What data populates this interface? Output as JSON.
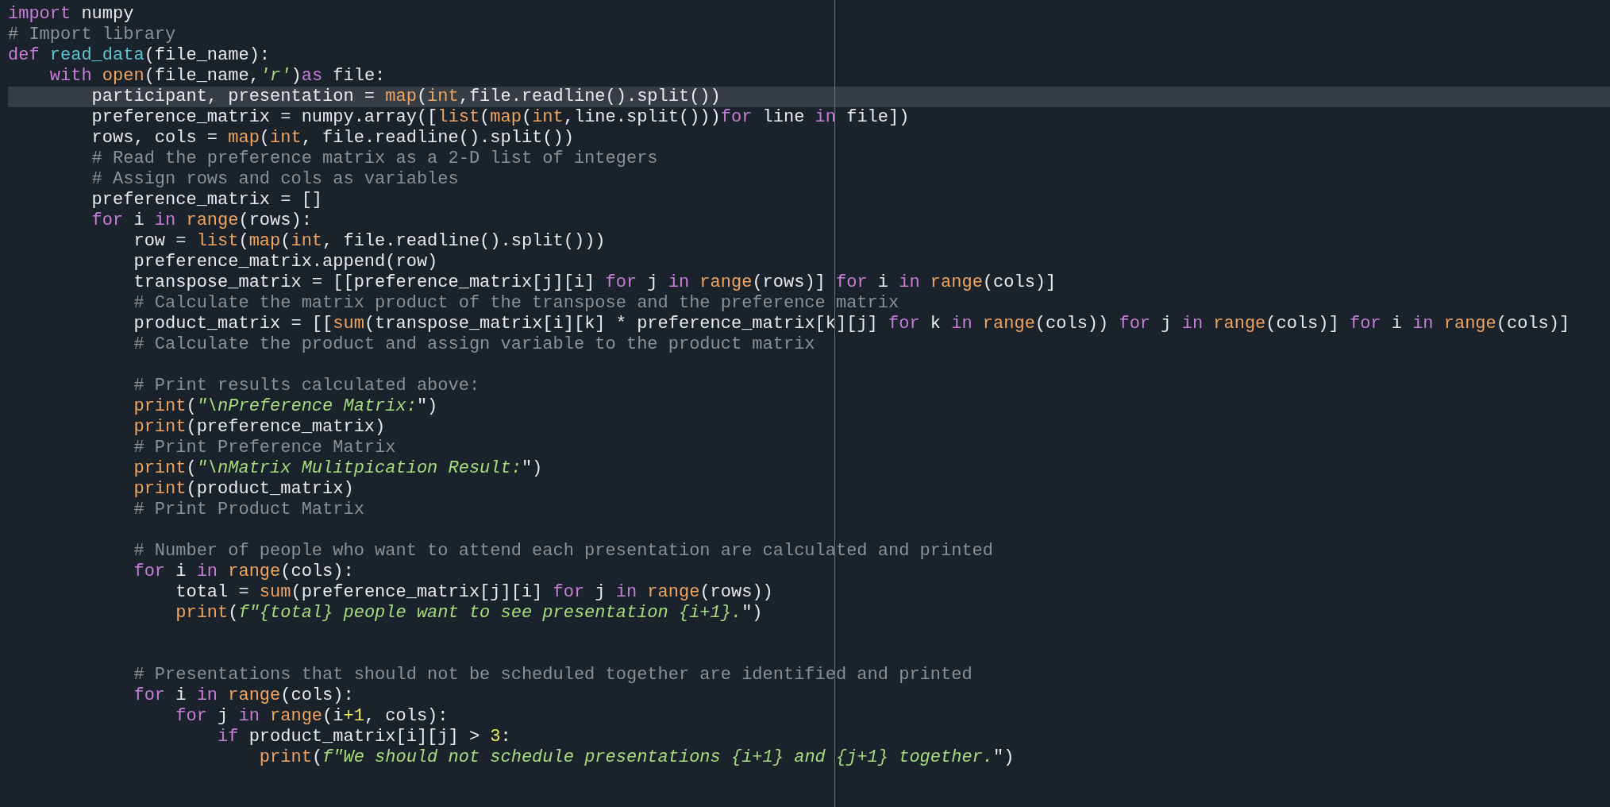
{
  "editor": {
    "lines": [
      {
        "selected": false,
        "tokens": [
          {
            "kind": "keyword",
            "text": "import"
          },
          {
            "kind": "plain",
            "text": " numpy"
          }
        ]
      },
      {
        "selected": false,
        "tokens": [
          {
            "kind": "comment",
            "text": "# Import library"
          }
        ]
      },
      {
        "selected": false,
        "tokens": [
          {
            "kind": "keyword",
            "text": "def"
          },
          {
            "kind": "function",
            "text": " read_data"
          },
          {
            "kind": "plain",
            "text": "(file_name):"
          }
        ]
      },
      {
        "selected": false,
        "tokens": [
          {
            "kind": "keyword",
            "text": "    with"
          },
          {
            "kind": "builtin",
            "text": " open"
          },
          {
            "kind": "plain",
            "text": "(file_name,"
          },
          {
            "kind": "string",
            "text": "'r'"
          },
          {
            "kind": "plain",
            "text": ")"
          },
          {
            "kind": "keyword",
            "text": "as"
          },
          {
            "kind": "plain",
            "text": " file:"
          }
        ]
      },
      {
        "selected": true,
        "tokens": [
          {
            "kind": "plain",
            "text": "        participant, presentation = "
          },
          {
            "kind": "builtin",
            "text": "map"
          },
          {
            "kind": "plain",
            "text": "("
          },
          {
            "kind": "builtin",
            "text": "int"
          },
          {
            "kind": "plain",
            "text": ",file.readline().split())"
          }
        ]
      },
      {
        "selected": false,
        "tokens": [
          {
            "kind": "plain",
            "text": "        preference_matrix = numpy.array(["
          },
          {
            "kind": "builtin",
            "text": "list"
          },
          {
            "kind": "plain",
            "text": "("
          },
          {
            "kind": "builtin",
            "text": "map"
          },
          {
            "kind": "plain",
            "text": "("
          },
          {
            "kind": "builtin",
            "text": "int"
          },
          {
            "kind": "plain",
            "text": ",line.split()))"
          },
          {
            "kind": "keyword",
            "text": "for"
          },
          {
            "kind": "plain",
            "text": " line "
          },
          {
            "kind": "keyword",
            "text": "in"
          },
          {
            "kind": "plain",
            "text": " file])"
          }
        ]
      },
      {
        "selected": false,
        "tokens": [
          {
            "kind": "plain",
            "text": "        rows, cols = "
          },
          {
            "kind": "builtin",
            "text": "map"
          },
          {
            "kind": "plain",
            "text": "("
          },
          {
            "kind": "builtin",
            "text": "int"
          },
          {
            "kind": "plain",
            "text": ", file.readline().split())"
          }
        ]
      },
      {
        "selected": false,
        "tokens": [
          {
            "kind": "comment",
            "text": "        # Read the preference matrix as a 2-D list of integers"
          }
        ]
      },
      {
        "selected": false,
        "tokens": [
          {
            "kind": "comment",
            "text": "        # Assign rows and cols as variables"
          }
        ]
      },
      {
        "selected": false,
        "tokens": [
          {
            "kind": "plain",
            "text": "        preference_matrix = []"
          }
        ]
      },
      {
        "selected": false,
        "tokens": [
          {
            "kind": "keyword",
            "text": "        for"
          },
          {
            "kind": "plain",
            "text": " i "
          },
          {
            "kind": "keyword",
            "text": "in"
          },
          {
            "kind": "builtin",
            "text": " range"
          },
          {
            "kind": "plain",
            "text": "(rows):"
          }
        ]
      },
      {
        "selected": false,
        "tokens": [
          {
            "kind": "plain",
            "text": "            row = "
          },
          {
            "kind": "builtin",
            "text": "list"
          },
          {
            "kind": "plain",
            "text": "("
          },
          {
            "kind": "builtin",
            "text": "map"
          },
          {
            "kind": "plain",
            "text": "("
          },
          {
            "kind": "builtin",
            "text": "int"
          },
          {
            "kind": "plain",
            "text": ", file.readline().split()))"
          }
        ]
      },
      {
        "selected": false,
        "tokens": [
          {
            "kind": "plain",
            "text": "            preference_matrix.append(row)"
          }
        ]
      },
      {
        "selected": false,
        "tokens": [
          {
            "kind": "plain",
            "text": "            transpose_matrix = [[preference_matrix[j][i] "
          },
          {
            "kind": "keyword",
            "text": "for"
          },
          {
            "kind": "plain",
            "text": " j "
          },
          {
            "kind": "keyword",
            "text": "in"
          },
          {
            "kind": "builtin",
            "text": " range"
          },
          {
            "kind": "plain",
            "text": "(rows)] "
          },
          {
            "kind": "keyword",
            "text": "for"
          },
          {
            "kind": "plain",
            "text": " i "
          },
          {
            "kind": "keyword",
            "text": "in"
          },
          {
            "kind": "builtin",
            "text": " range"
          },
          {
            "kind": "plain",
            "text": "(cols)]"
          }
        ]
      },
      {
        "selected": false,
        "tokens": [
          {
            "kind": "comment",
            "text": "            # Calculate the matrix product of the transpose and the preference matrix"
          }
        ]
      },
      {
        "selected": false,
        "tokens": [
          {
            "kind": "plain",
            "text": "            product_matrix = [["
          },
          {
            "kind": "builtin",
            "text": "sum"
          },
          {
            "kind": "plain",
            "text": "(transpose_matrix[i][k] * preference_matrix[k][j] "
          },
          {
            "kind": "keyword",
            "text": "for"
          },
          {
            "kind": "plain",
            "text": " k "
          },
          {
            "kind": "keyword",
            "text": "in"
          },
          {
            "kind": "builtin",
            "text": " range"
          },
          {
            "kind": "plain",
            "text": "(cols)) "
          },
          {
            "kind": "keyword",
            "text": "for"
          },
          {
            "kind": "plain",
            "text": " j "
          },
          {
            "kind": "keyword",
            "text": "in"
          },
          {
            "kind": "builtin",
            "text": " range"
          },
          {
            "kind": "plain",
            "text": "(cols)] "
          },
          {
            "kind": "keyword",
            "text": "for"
          },
          {
            "kind": "plain",
            "text": " i "
          },
          {
            "kind": "keyword",
            "text": "in"
          },
          {
            "kind": "builtin",
            "text": " range"
          },
          {
            "kind": "plain",
            "text": "(cols)]"
          }
        ]
      },
      {
        "selected": false,
        "tokens": [
          {
            "kind": "comment",
            "text": "            # Calculate the product and assign variable to the product matrix"
          }
        ]
      },
      {
        "selected": false
      },
      {
        "selected": false,
        "tokens": [
          {
            "kind": "comment",
            "text": "            # Print results calculated above:"
          }
        ]
      },
      {
        "selected": false,
        "tokens": [
          {
            "kind": "builtin",
            "text": "            print"
          },
          {
            "kind": "plain",
            "text": "("
          },
          {
            "kind": "string",
            "text": "\"\\nPreference Matrix:"
          },
          {
            "kind": "plain",
            "text": "\")"
          }
        ]
      },
      {
        "selected": false,
        "tokens": [
          {
            "kind": "builtin",
            "text": "            print"
          },
          {
            "kind": "plain",
            "text": "(preference_matrix)"
          }
        ]
      },
      {
        "selected": false,
        "tokens": [
          {
            "kind": "comment",
            "text": "            # Print Preference Matrix"
          }
        ]
      },
      {
        "selected": false,
        "tokens": [
          {
            "kind": "builtin",
            "text": "            print"
          },
          {
            "kind": "plain",
            "text": "("
          },
          {
            "kind": "string",
            "text": "\"\\nMatrix Mulitpication Result:"
          },
          {
            "kind": "plain",
            "text": "\")"
          }
        ]
      },
      {
        "selected": false,
        "tokens": [
          {
            "kind": "builtin",
            "text": "            print"
          },
          {
            "kind": "plain",
            "text": "(product_matrix)"
          }
        ]
      },
      {
        "selected": false,
        "tokens": [
          {
            "kind": "comment",
            "text": "            # Print Product Matrix"
          }
        ]
      },
      {
        "selected": false
      },
      {
        "selected": false,
        "tokens": [
          {
            "kind": "comment",
            "text": "            # Number of people who want to attend each presentation are calculated and printed"
          }
        ]
      },
      {
        "selected": false,
        "tokens": [
          {
            "kind": "keyword",
            "text": "            for"
          },
          {
            "kind": "plain",
            "text": " i "
          },
          {
            "kind": "keyword",
            "text": "in"
          },
          {
            "kind": "builtin",
            "text": " range"
          },
          {
            "kind": "plain",
            "text": "(cols):"
          }
        ]
      },
      {
        "selected": false,
        "tokens": [
          {
            "kind": "plain",
            "text": "                total = "
          },
          {
            "kind": "builtin",
            "text": "sum"
          },
          {
            "kind": "plain",
            "text": "(preference_matrix[j][i] "
          },
          {
            "kind": "keyword",
            "text": "for"
          },
          {
            "kind": "plain",
            "text": " j "
          },
          {
            "kind": "keyword",
            "text": "in"
          },
          {
            "kind": "builtin",
            "text": " range"
          },
          {
            "kind": "plain",
            "text": "(rows))"
          }
        ]
      },
      {
        "selected": false,
        "tokens": [
          {
            "kind": "builtin",
            "text": "                print"
          },
          {
            "kind": "plain",
            "text": "("
          },
          {
            "kind": "string",
            "text": "f\"{total} people want to see presentation {i+1}."
          },
          {
            "kind": "plain",
            "text": "\")"
          }
        ]
      },
      {
        "selected": false
      },
      {
        "selected": false
      },
      {
        "selected": false,
        "tokens": [
          {
            "kind": "comment",
            "text": "            # Presentations that should not be scheduled together are identified and printed"
          }
        ]
      },
      {
        "selected": false,
        "tokens": [
          {
            "kind": "keyword",
            "text": "            for"
          },
          {
            "kind": "plain",
            "text": " i "
          },
          {
            "kind": "keyword",
            "text": "in"
          },
          {
            "kind": "builtin",
            "text": " range"
          },
          {
            "kind": "plain",
            "text": "(cols):"
          }
        ]
      },
      {
        "selected": false,
        "tokens": [
          {
            "kind": "keyword",
            "text": "                for"
          },
          {
            "kind": "plain",
            "text": " j "
          },
          {
            "kind": "keyword",
            "text": "in"
          },
          {
            "kind": "builtin",
            "text": " range"
          },
          {
            "kind": "plain",
            "text": "(i"
          },
          {
            "kind": "number",
            "text": "+1"
          },
          {
            "kind": "plain",
            "text": ", cols):"
          }
        ]
      },
      {
        "selected": false,
        "tokens": [
          {
            "kind": "keyword",
            "text": "                    if"
          },
          {
            "kind": "plain",
            "text": " product_matrix[i][j] > "
          },
          {
            "kind": "number",
            "text": "3"
          },
          {
            "kind": "plain",
            "text": ":"
          }
        ]
      },
      {
        "selected": false,
        "tokens": [
          {
            "kind": "builtin",
            "text": "                        print"
          },
          {
            "kind": "plain",
            "text": "("
          },
          {
            "kind": "string",
            "text": "f\"We should not schedule presentations {i+1} and {j+1} together."
          },
          {
            "kind": "plain",
            "text": "\")"
          }
        ]
      }
    ]
  }
}
